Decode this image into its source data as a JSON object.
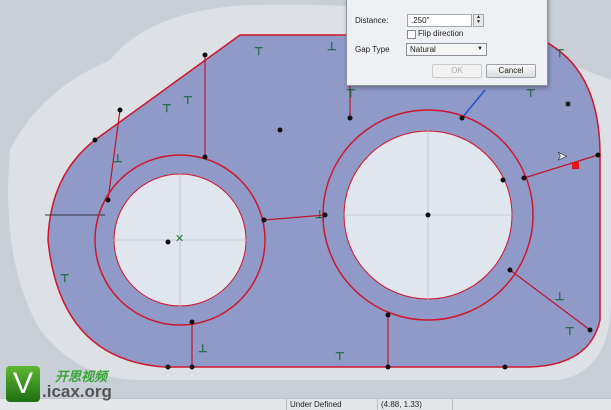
{
  "dialog": {
    "distance_label": "Distance:",
    "distance_value": ".250\"",
    "flip_label": "Flip direction",
    "gap_type_label": "Gap Type",
    "gap_type_value": "Natural",
    "ok_label": "OK",
    "cancel_label": "Cancel"
  },
  "status_bar": {
    "state": "Under Defined",
    "coords": "(4.88, 1.33)"
  },
  "watermark": {
    "chinese": "开思视频",
    "url": ".icax.org",
    "logo_letter": "V"
  },
  "colors": {
    "sketch_fill": "#8f9ac9",
    "sketch_line": "#d0162a",
    "hole_fill": "#dfe6ee",
    "background": "#c9cfd6"
  }
}
